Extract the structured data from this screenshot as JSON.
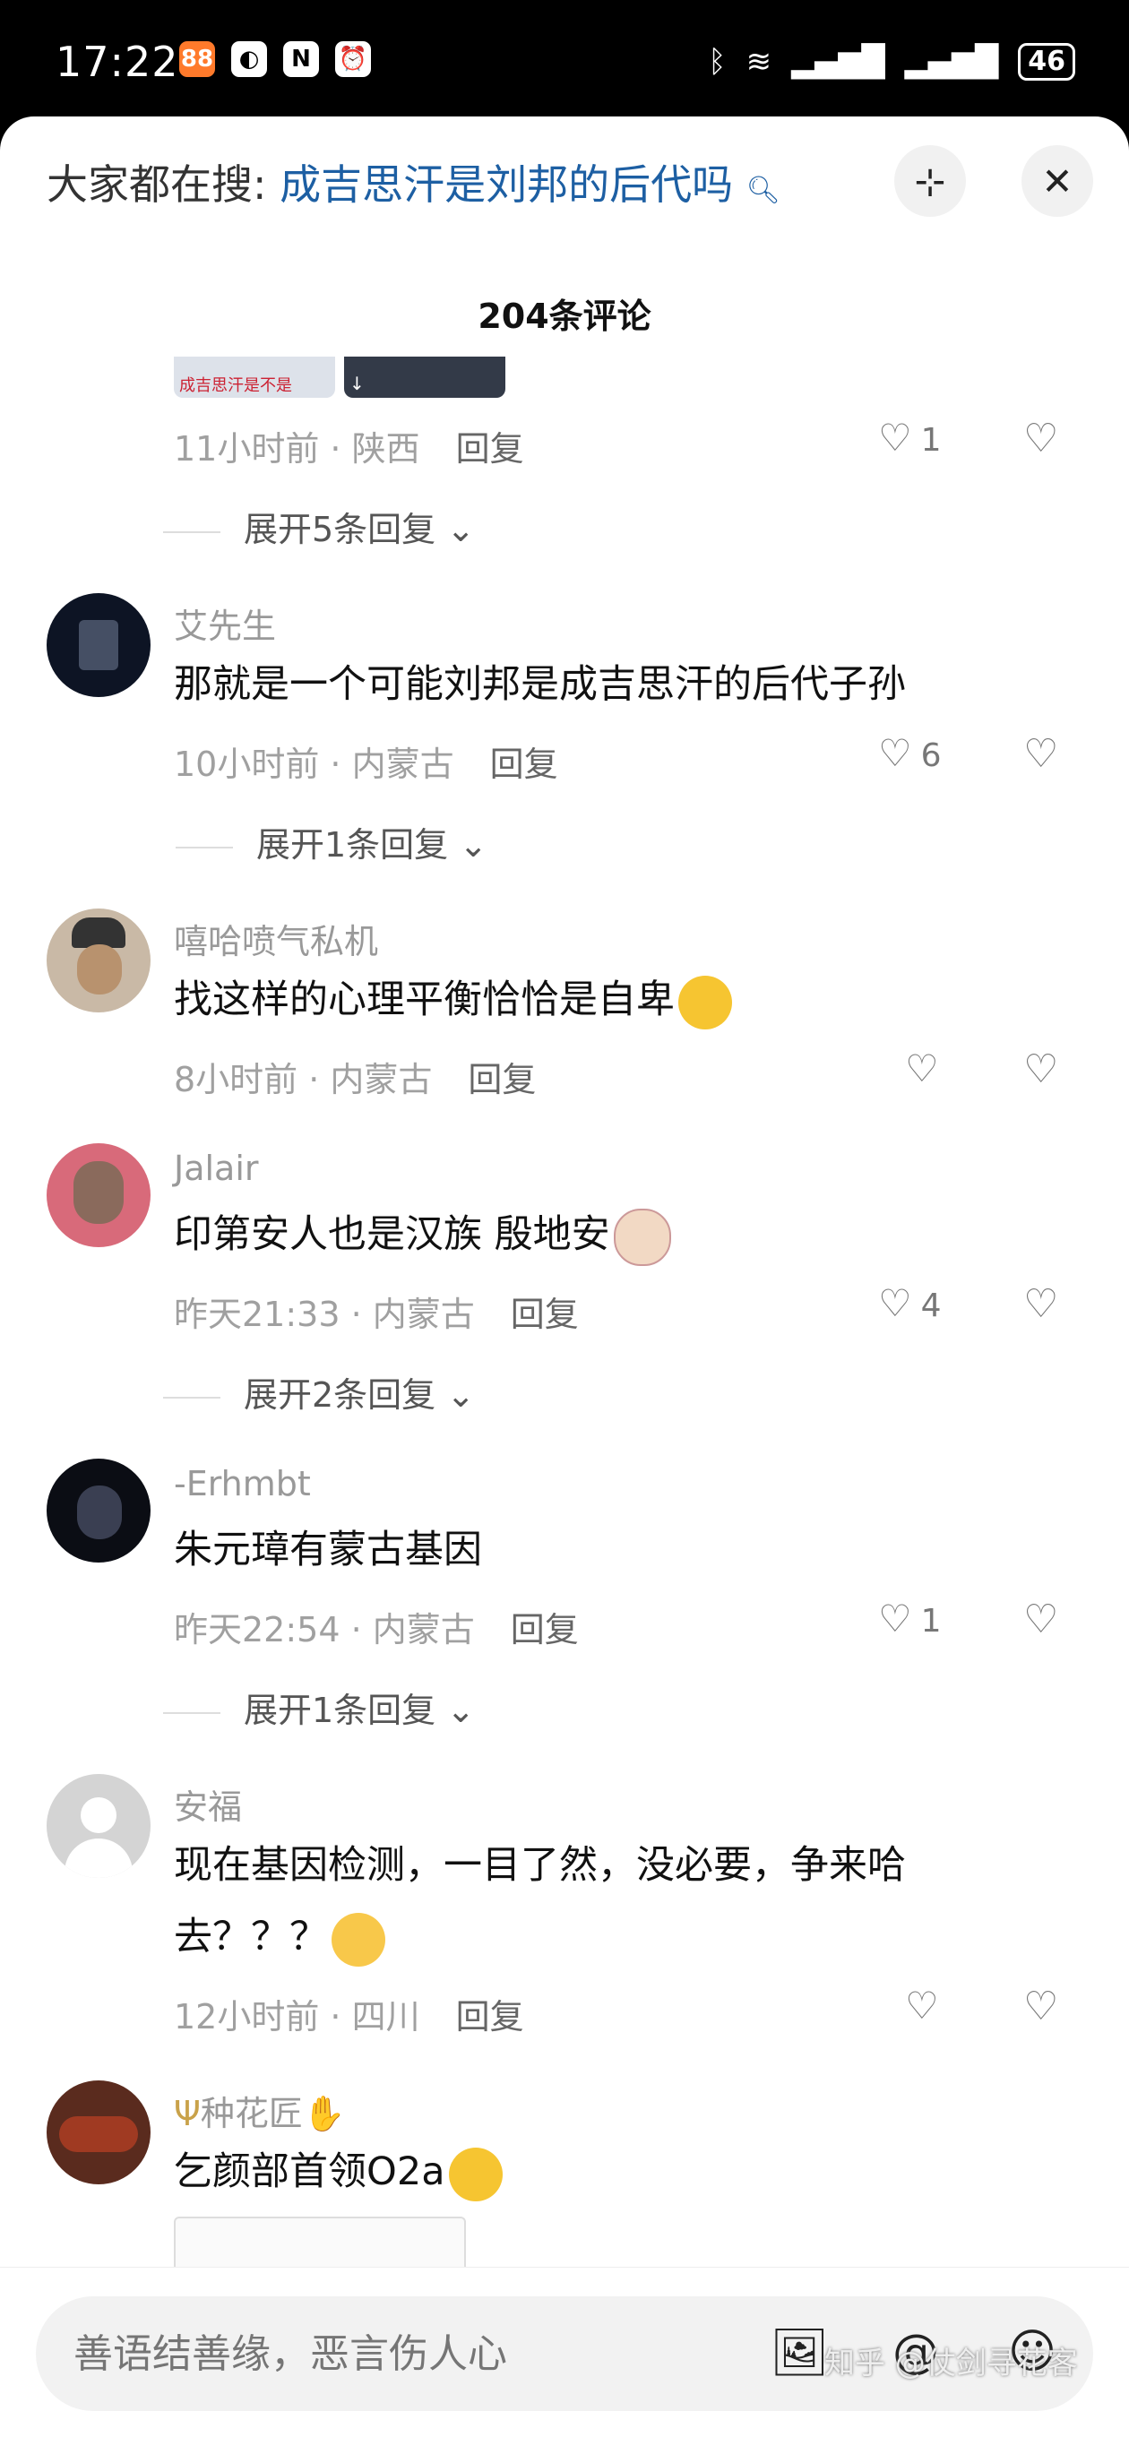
{
  "status": {
    "time": "17:22",
    "battery": "46"
  },
  "header": {
    "search_prefix": "大家都在搜:",
    "search_query": "成吉思汗是刘邦的后代吗",
    "count": "204条评论"
  },
  "thumb_label": "成吉思汗是不是",
  "top_meta": {
    "time_loc": "11小时前 · 陕西",
    "reply": "回复",
    "likes": "1"
  },
  "top_expand": "展开5条回复",
  "comments": [
    {
      "name": "艾先生",
      "text": "那就是一个可能刘邦是成吉思汗的后代子孙",
      "time_loc": "10小时前 · 内蒙古",
      "reply": "回复",
      "likes": "6",
      "expand": "展开1条回复"
    },
    {
      "name": "嘻哈喷气私机",
      "text": "找这样的心理平衡恰恰是自卑",
      "time_loc": "8小时前 · 内蒙古",
      "reply": "回复",
      "likes": ""
    },
    {
      "name": "Jalair",
      "text": "印第安人也是汉族 殷地安",
      "time_loc": "昨天21:33 · 内蒙古",
      "reply": "回复",
      "likes": "4",
      "expand": "展开2条回复"
    },
    {
      "name": "-Erhmbt",
      "text": "朱元璋有蒙古基因",
      "time_loc": "昨天22:54 · 内蒙古",
      "reply": "回复",
      "likes": "1",
      "expand": "展开1条回复"
    },
    {
      "name": "安福",
      "text": "现在基因检测，一目了然，没必要，争来哈去？？？",
      "time_loc": "12小时前 · 四川",
      "reply": "回复",
      "likes": ""
    },
    {
      "name": "种花匠",
      "text": "乞颜部首领O2a"
    }
  ],
  "input": {
    "placeholder": "善语结善缘，恶言伤人心"
  },
  "watermark": "知乎 @仗剑寻花客"
}
